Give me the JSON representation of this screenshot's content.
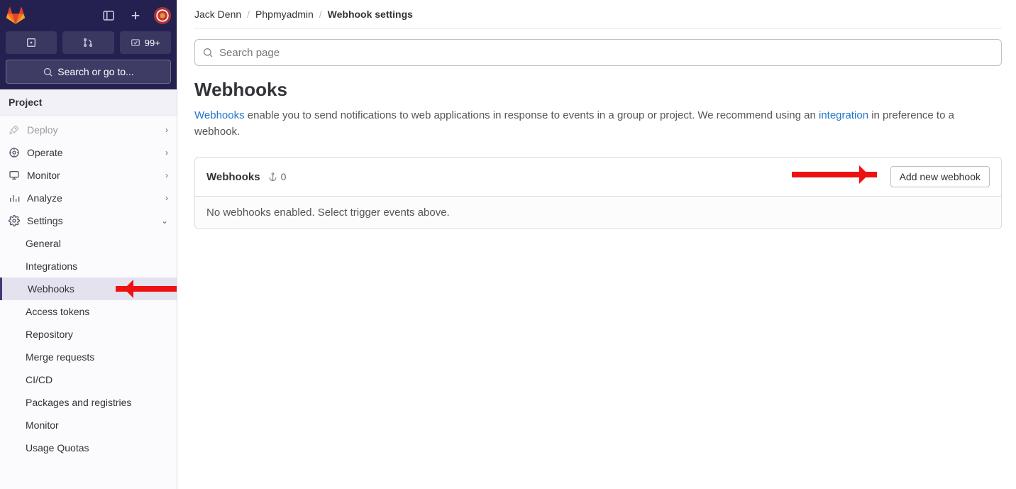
{
  "topbar": {
    "todos_badge": "99+",
    "search_label": "Search or go to..."
  },
  "sidebar": {
    "section": "Project",
    "items": [
      {
        "icon": "deploy",
        "label": "Deploy"
      },
      {
        "icon": "operate",
        "label": "Operate"
      },
      {
        "icon": "monitor",
        "label": "Monitor"
      },
      {
        "icon": "analyze",
        "label": "Analyze"
      },
      {
        "icon": "settings",
        "label": "Settings"
      }
    ],
    "settings_sub": [
      "General",
      "Integrations",
      "Webhooks",
      "Access tokens",
      "Repository",
      "Merge requests",
      "CI/CD",
      "Packages and registries",
      "Monitor",
      "Usage Quotas"
    ]
  },
  "breadcrumb": [
    "Jack Denn",
    "Phpmyadmin",
    "Webhook settings"
  ],
  "search_placeholder": "Search page",
  "page": {
    "title": "Webhooks",
    "desc_link1": "Webhooks",
    "desc_part1": " enable you to send notifications to web applications in response to events in a group or project. We recommend using an ",
    "desc_link2": "integration",
    "desc_part2": " in preference to a webhook."
  },
  "card": {
    "title": "Webhooks",
    "count": "0",
    "add_btn": "Add new webhook",
    "empty": "No webhooks enabled. Select trigger events above."
  }
}
